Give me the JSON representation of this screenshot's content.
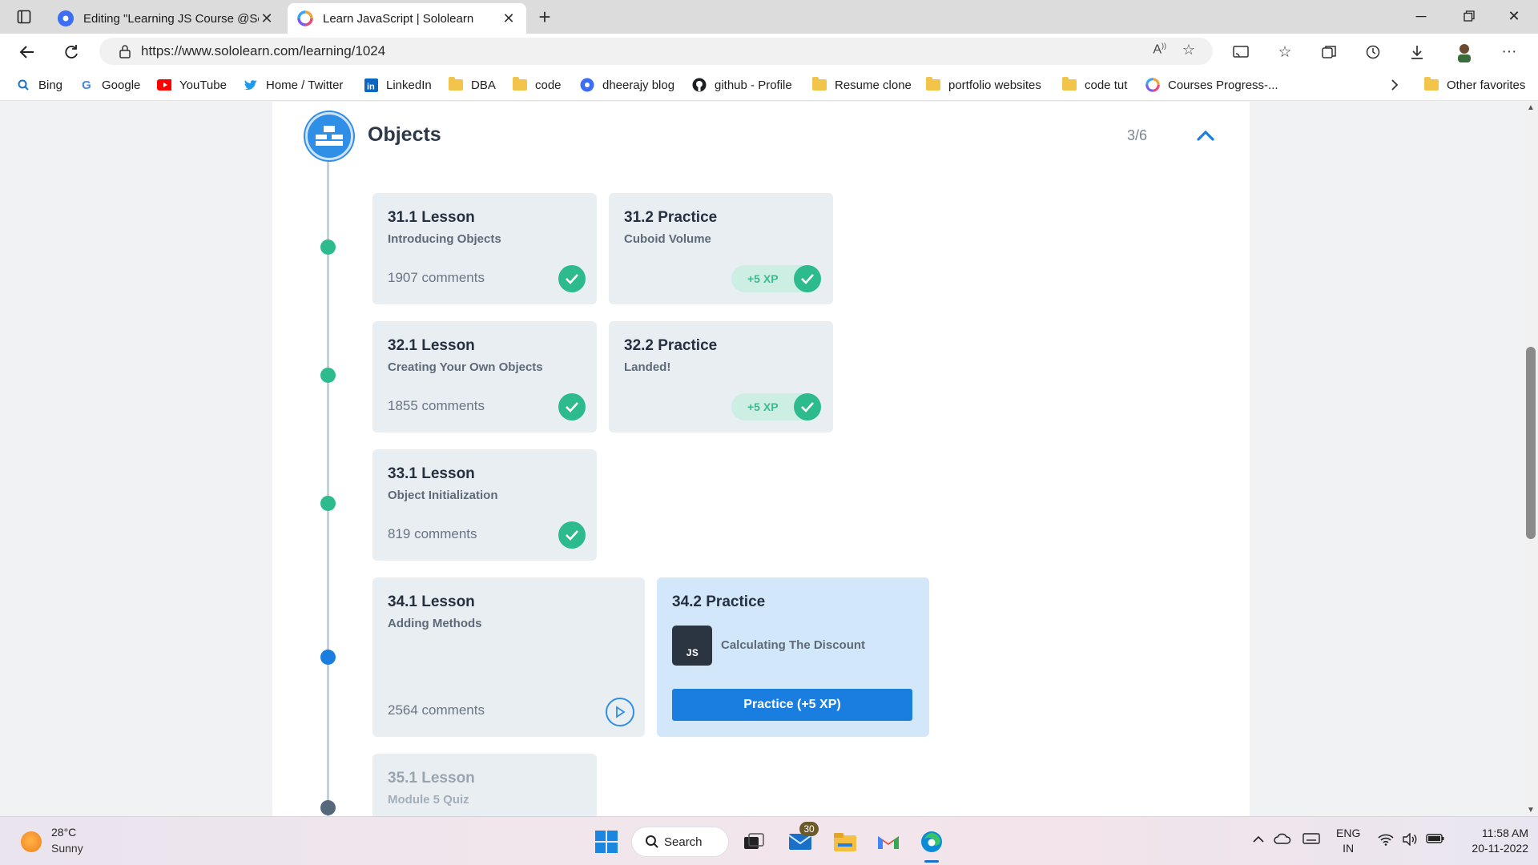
{
  "browser": {
    "tabs": [
      {
        "title": "Editing \"Learning JS Course @Sc",
        "active": false
      },
      {
        "title": "Learn JavaScript | Sololearn",
        "active": true
      }
    ],
    "url": "https://www.sololearn.com/learning/1024",
    "favorites": [
      {
        "label": "Bing",
        "icon": "bing-search-icon"
      },
      {
        "label": "Google",
        "icon": "google-icon"
      },
      {
        "label": "YouTube",
        "icon": "youtube-icon"
      },
      {
        "label": "Home / Twitter",
        "icon": "twitter-icon"
      },
      {
        "label": "LinkedIn",
        "icon": "linkedin-icon"
      },
      {
        "label": "DBA",
        "icon": "folder-icon"
      },
      {
        "label": "code",
        "icon": "folder-icon"
      },
      {
        "label": "dheerajy blog",
        "icon": "blog-icon"
      },
      {
        "label": "github - Profile",
        "icon": "github-icon"
      },
      {
        "label": "Resume clone",
        "icon": "folder-icon"
      },
      {
        "label": "portfolio websites",
        "icon": "folder-icon"
      },
      {
        "label": "code tut",
        "icon": "folder-icon"
      },
      {
        "label": "Courses Progress-...",
        "icon": "sololearn-icon"
      }
    ],
    "other_favorites": "Other favorites"
  },
  "module": {
    "title": "Objects",
    "progress": "3/6",
    "items": [
      {
        "num": "31.1 Lesson",
        "sub": "Introducing Objects",
        "comments": "1907 comments",
        "status": "completed"
      },
      {
        "num": "31.2 Practice",
        "sub": "Cuboid Volume",
        "xp": "+5 XP",
        "status": "completed"
      },
      {
        "num": "32.1 Lesson",
        "sub": "Creating Your Own Objects",
        "comments": "1855 comments",
        "status": "completed"
      },
      {
        "num": "32.2 Practice",
        "sub": "Landed!",
        "xp": "+5 XP",
        "status": "completed"
      },
      {
        "num": "33.1 Lesson",
        "sub": "Object Initialization",
        "comments": "819 comments",
        "status": "completed"
      },
      {
        "num": "34.1 Lesson",
        "sub": "Adding Methods",
        "comments": "2564 comments",
        "status": "in-progress"
      },
      {
        "num": "34.2 Practice",
        "sub": "Calculating The Discount",
        "badge": "JS",
        "button": "Practice (+5 XP)",
        "status": "current"
      },
      {
        "num": "35.1 Lesson",
        "sub": "Module 5 Quiz",
        "status": "locked"
      }
    ]
  },
  "taskbar": {
    "weather": {
      "temp": "28°C",
      "condition": "Sunny"
    },
    "search_label": "Search",
    "mail_badge": "30",
    "language": {
      "line1": "ENG",
      "line2": "IN"
    },
    "time": "11:58 AM",
    "date": "20-11-2022"
  },
  "colors": {
    "accent": "#1a7ee0",
    "complete": "#2dbb8e",
    "card_bg": "#e9eef3",
    "card_active_bg": "#d3e7fa"
  }
}
